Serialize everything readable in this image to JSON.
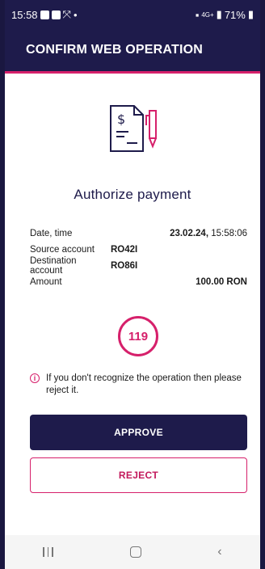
{
  "status_bar": {
    "time": "15:58",
    "signal": "4G+",
    "battery": "71%"
  },
  "app_bar": {
    "title": "CONFIRM WEB OPERATION"
  },
  "main": {
    "title": "Authorize payment",
    "details": {
      "date_label": "Date, time",
      "date_value": "23.02.24,",
      "time_value": " 15:58:06",
      "source_label": "Source account",
      "source_value": "RO42I",
      "dest_label": "Destination account",
      "dest_value": "RO86I",
      "amount_label": "Amount",
      "amount_value": "100.00 RON"
    },
    "timer": "119",
    "warning": "If you don't recognize the operation then please reject it.",
    "approve_label": "APPROVE",
    "reject_label": "REJECT"
  },
  "icons": [
    "document-pen-icon",
    "info-icon",
    "recent-apps-icon",
    "home-icon",
    "back-icon"
  ],
  "colors": {
    "primary": "#1e1b4b",
    "accent": "#d6206b"
  }
}
